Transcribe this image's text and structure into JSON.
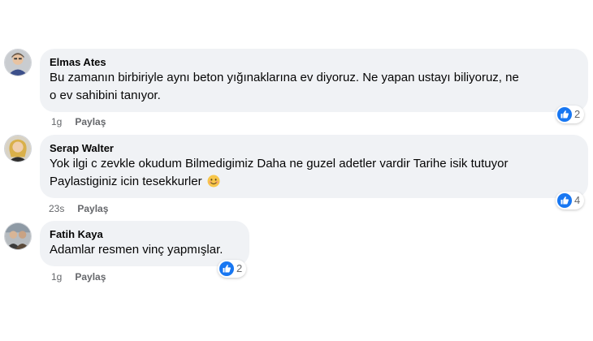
{
  "comments": [
    {
      "author": "Elmas Ates",
      "text_line1": "Bu zamanın birbiriyle aynı beton yığınaklarına ev diyoruz. Ne yapan ustayı biliyoruz, ne",
      "text_line2": "o ev sahibini tanıyor.",
      "reactions": "2",
      "reaction_icon": "like-icon",
      "time": "1g",
      "reply": "Paylaş"
    },
    {
      "author": "Serap Walter",
      "text_line1": "Yok ilgi c zevkle okudum Bilmedigimiz Daha ne guzel adetler vardir Tarihe isik tutuyor",
      "text_line2": "Paylastiginiz icin tesekkurler",
      "emoji": "smiling-face-emoji",
      "reactions": "4",
      "reaction_icon": "like-icon",
      "time": "23s",
      "reply": "Paylaş"
    },
    {
      "author": "Fatih Kaya",
      "text_line1": "Adamlar resmen vinç yapmışlar.",
      "reactions": "2",
      "reaction_icon": "like-icon",
      "time": "1g",
      "reply": "Paylaş"
    }
  ],
  "colors": {
    "bubble": "#f0f2f5",
    "like_blue": "#1877f2",
    "meta_gray": "#65676b"
  }
}
